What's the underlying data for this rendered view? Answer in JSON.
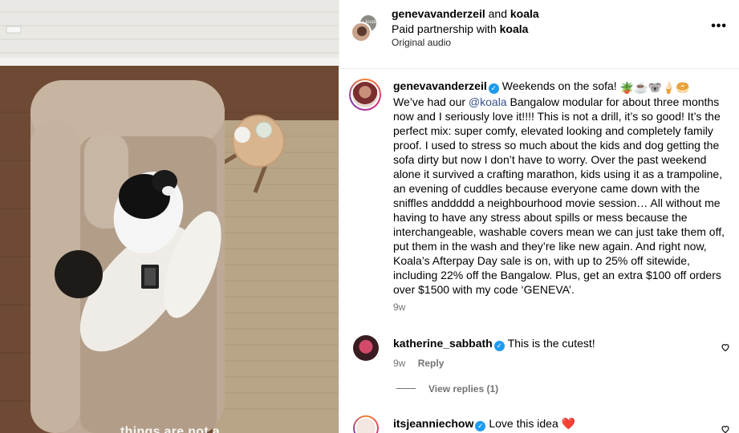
{
  "header": {
    "user1": "genevavanderzeil",
    "and": "and",
    "user2": "koala",
    "partnership_prefix": "Paid partnership with",
    "partnership_brand": "koala",
    "audio": "Original audio",
    "more_label": "•••"
  },
  "caption": {
    "username": "genevavanderzeil",
    "first_line": "Weekends on the sofa!",
    "emojis": "🪴☕️🐨🍦🥯",
    "pre_mention": "We’ve had our ",
    "mention": "@koala",
    "body": " Bangalow modular for about three months now and I seriously love it!!!! This is not a drill, it’s so good! It’s the perfect mix: super comfy, elevated looking and completely family proof. I used to stress so much about the kids and dog getting the sofa dirty but now I don’t have to worry. Over the past weekend alone it survived a crafting marathon, kids using it as a trampoline, an evening of cuddles because everyone came down with the sniffles anddddd a neighbourhood movie session… All without me having to have any stress about spills or mess because the interchangeable, washable covers mean we can just take them off, put them in the wash and they’re like new again. And right now, Koala’s Afterpay Day sale is on, with up to 25% off sitewide, including 22% off the Bangalow. Plus, get an extra $100 off orders over $1500 with my code ‘GENEVA’.",
    "time": "9w"
  },
  "comments": [
    {
      "username": "katherine_sabbath",
      "text": "This is the cutest!",
      "time": "9w",
      "reply": "Reply"
    },
    {
      "username": "itsjeanniechow",
      "text": "Love this idea",
      "emoji": "❤️"
    }
  ],
  "view_replies": "View replies (1)",
  "photo_overlay_text": "things are not a",
  "colors": {
    "verified": "#1d9bf0",
    "mention": "#385185",
    "muted": "#737373"
  }
}
